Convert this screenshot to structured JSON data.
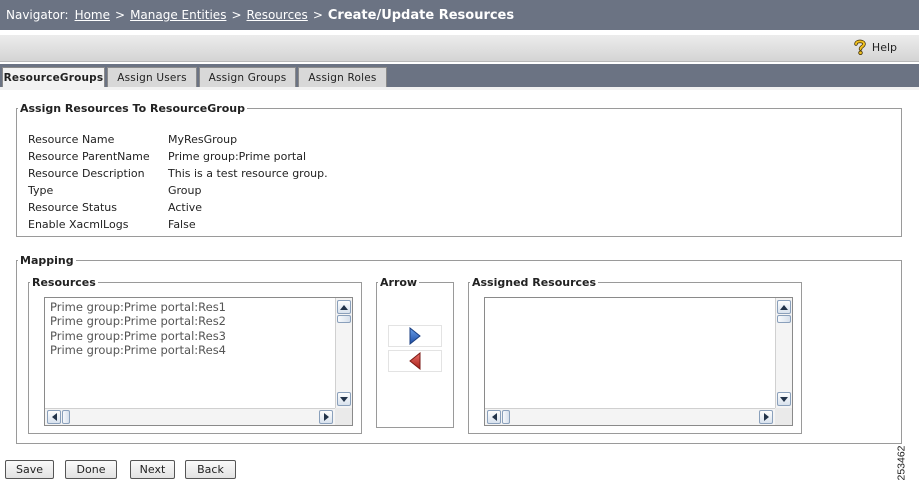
{
  "navigator": {
    "prefix": "Navigator:",
    "breadcrumb": [
      "Home",
      "Manage Entities",
      "Resources"
    ],
    "separator": ">",
    "current": "Create/Update Resources"
  },
  "help": {
    "label": "Help",
    "icon": "question-mark-icon"
  },
  "tabs": [
    {
      "label": "ResourceGroups",
      "active": true
    },
    {
      "label": "Assign Users",
      "active": false
    },
    {
      "label": "Assign Groups",
      "active": false
    },
    {
      "label": "Assign Roles",
      "active": false
    }
  ],
  "details": {
    "legend": "Assign Resources To ResourceGroup",
    "rows": [
      {
        "label": "Resource Name",
        "value": "MyResGroup"
      },
      {
        "label": "Resource ParentName",
        "value": "Prime group:Prime portal"
      },
      {
        "label": "Resource Description",
        "value": "This is a test resource group."
      },
      {
        "label": "Type",
        "value": "Group"
      },
      {
        "label": "Resource Status",
        "value": "Active"
      },
      {
        "label": "Enable XacmlLogs",
        "value": "False"
      }
    ]
  },
  "mapping": {
    "legend": "Mapping",
    "resources": {
      "legend": "Resources",
      "items": [
        "Prime group:Prime portal:Res1",
        "Prime group:Prime portal:Res2",
        "Prime group:Prime portal:Res3",
        "Prime group:Prime portal:Res4"
      ]
    },
    "arrow": {
      "legend": "Arrow",
      "add_icon": "arrow-right-icon",
      "remove_icon": "arrow-left-icon"
    },
    "assigned": {
      "legend": "Assigned Resources",
      "items": []
    }
  },
  "buttons": {
    "save": "Save",
    "done": "Done",
    "next": "Next",
    "back": "Back"
  },
  "figure_id": "253462",
  "colors": {
    "header": "#6b7383",
    "arrow_add": "#2f5fb8",
    "arrow_remove": "#c0302a"
  }
}
